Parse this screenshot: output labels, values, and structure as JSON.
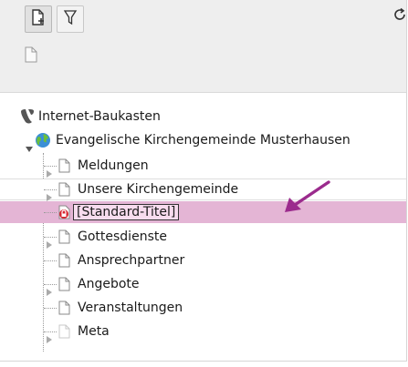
{
  "toolbar": {
    "new_page_icon": "new-page-icon",
    "filter_icon": "filter-icon",
    "refresh_icon": "refresh-icon",
    "page_icon": "page-icon"
  },
  "tree": {
    "root_label": "Internet-Baukasten",
    "site_label": "Evangelische Kirchengemeinde Musterhausen",
    "items": [
      {
        "label": "Meldungen"
      },
      {
        "label": "Unsere Kirchengemeinde"
      },
      {
        "label": "[Standard-Titel]"
      },
      {
        "label": "Gottesdienste"
      },
      {
        "label": "Ansprechpartner"
      },
      {
        "label": "Angebote"
      },
      {
        "label": "Veranstaltungen"
      },
      {
        "label": "Meta"
      }
    ]
  },
  "colors": {
    "selection": "#e4b5d5",
    "arrow": "#9b2b8d",
    "typo3_logo": "#555555"
  }
}
